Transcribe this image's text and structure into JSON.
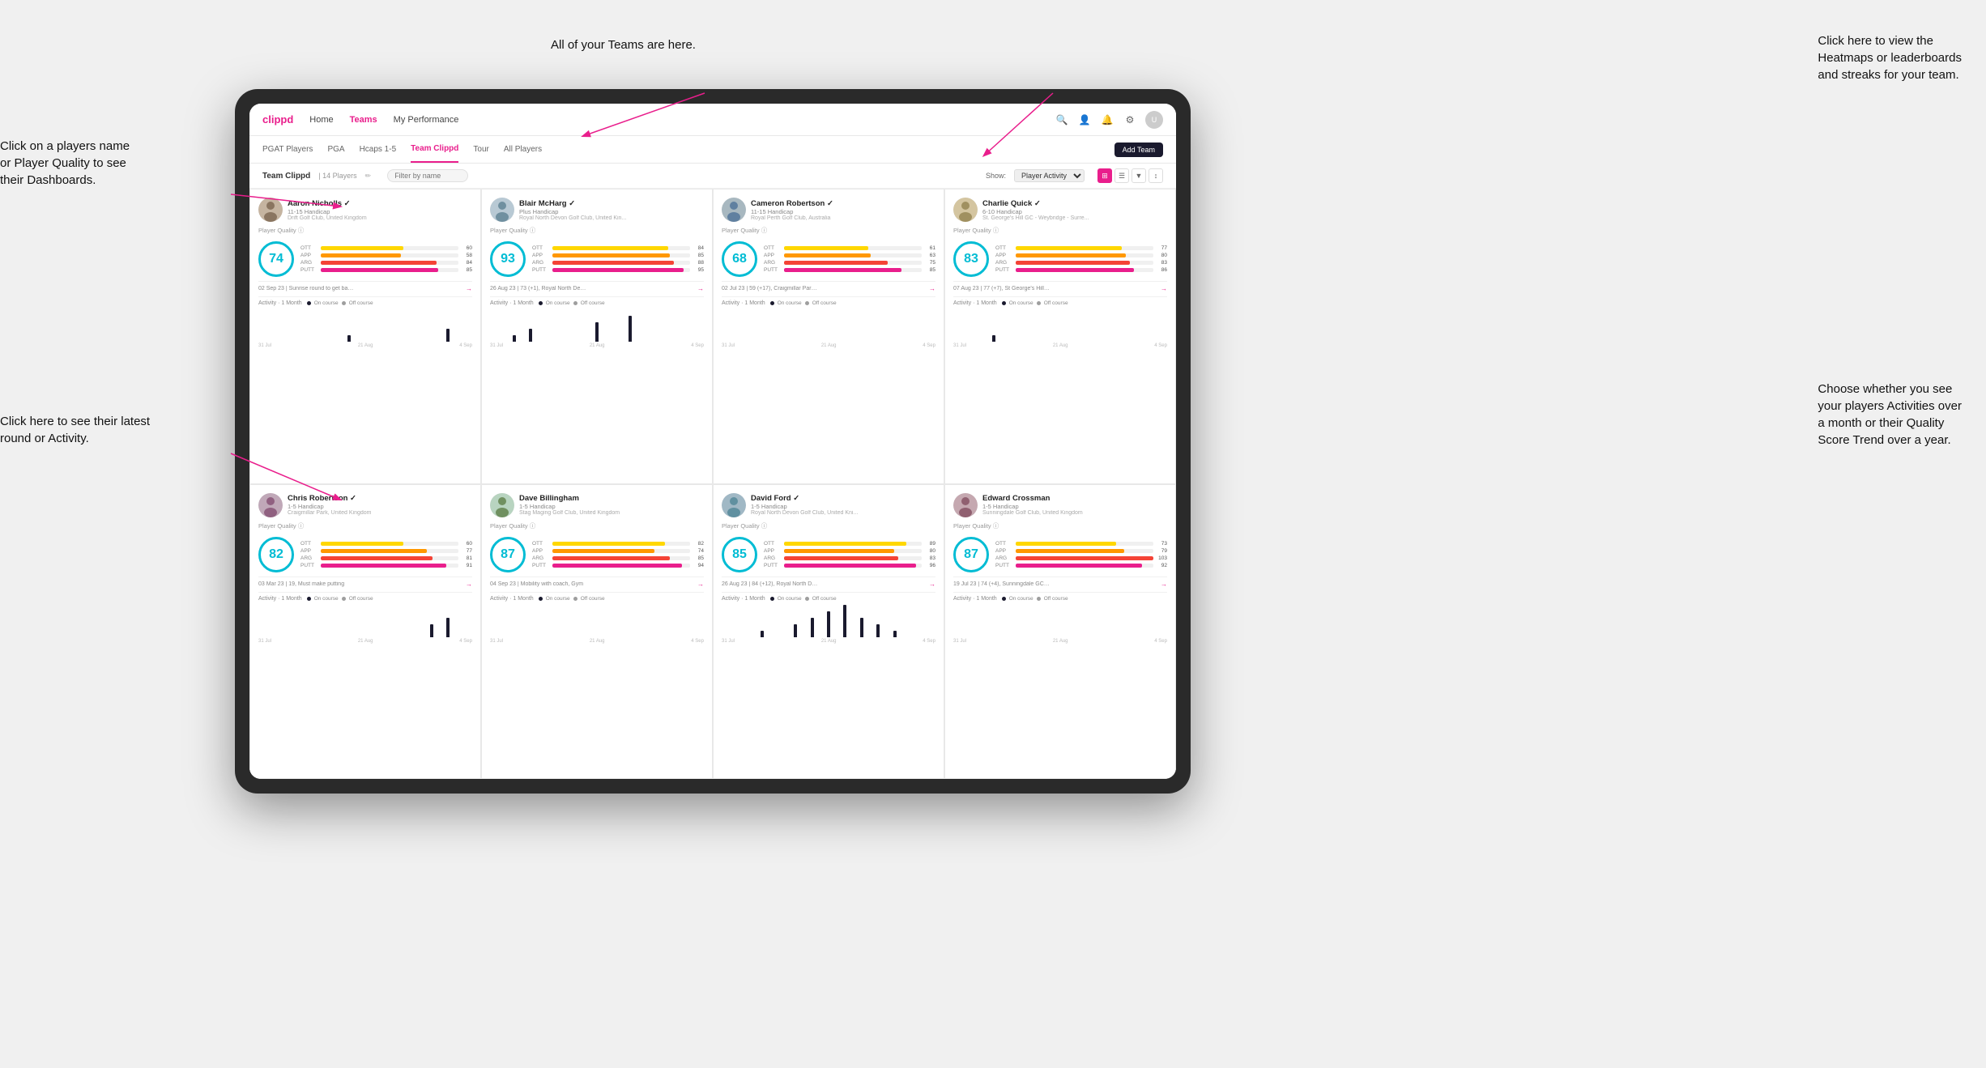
{
  "annotations": {
    "teams_tooltip": "All of your Teams are here.",
    "heatmaps_tooltip": "Click here to view the\nHeatmaps or leaderboards\nand streaks for your team.",
    "players_name_tooltip": "Click on a players name\nor Player Quality to see\ntheir Dashboards.",
    "latest_round_tooltip": "Click here to see their latest\nround or Activity.",
    "activity_tooltip": "Choose whether you see\nyour players Activities over\na month or their Quality\nScore Trend over a year."
  },
  "nav": {
    "logo": "clippd",
    "items": [
      "Home",
      "Teams",
      "My Performance"
    ],
    "active": "Teams",
    "add_team_label": "Add Team"
  },
  "sub_nav": {
    "items": [
      "PGAT Players",
      "PGA",
      "Hcaps 1-5",
      "Team Clippd",
      "Tour",
      "All Players"
    ],
    "active": "Team Clippd"
  },
  "team_header": {
    "name": "Team Clippd",
    "count": "14 Players",
    "filter_placeholder": "Filter by name",
    "show_label": "Show:",
    "show_value": "Player Activity",
    "view_options": [
      "grid",
      "table",
      "filter",
      "sort"
    ]
  },
  "players": [
    {
      "name": "Aaron Nicholls",
      "handicap": "11-15 Handicap",
      "club": "Drift Golf Club, United Kingdom",
      "quality": 74,
      "quality_color": "#00bcd4",
      "stats": {
        "ott": 60,
        "app": 58,
        "arg": 84,
        "putt": 85
      },
      "latest_round": "02 Sep 23 | Sunrise round to get back into it, F...",
      "activity_dates": [
        "31 Jul",
        "21 Aug",
        "4 Sep"
      ],
      "bars": [
        0,
        0,
        0,
        0,
        0,
        1,
        0,
        0,
        0,
        0,
        0,
        2,
        0
      ]
    },
    {
      "name": "Blair McHarg",
      "handicap": "Plus Handicap",
      "club": "Royal North Devon Golf Club, United Kin...",
      "quality": 93,
      "quality_color": "#00bcd4",
      "stats": {
        "ott": 84,
        "app": 85,
        "arg": 88,
        "putt": 95
      },
      "latest_round": "26 Aug 23 | 73 (+1), Royal North Devon GC",
      "activity_dates": [
        "31 Jul",
        "21 Aug",
        "4 Sep"
      ],
      "bars": [
        0,
        1,
        2,
        0,
        0,
        0,
        3,
        0,
        4,
        0,
        0,
        0,
        0
      ]
    },
    {
      "name": "Cameron Robertson",
      "handicap": "11-15 Handicap",
      "club": "Royal Perth Golf Club, Australia",
      "quality": 68,
      "quality_color": "#00bcd4",
      "stats": {
        "ott": 61,
        "app": 63,
        "arg": 75,
        "putt": 85
      },
      "latest_round": "02 Jul 23 | 59 (+17), Craigmillar Park GC",
      "activity_dates": [
        "31 Jul",
        "21 Aug",
        "4 Sep"
      ],
      "bars": [
        0,
        0,
        0,
        0,
        0,
        0,
        0,
        0,
        0,
        0,
        0,
        0,
        0
      ]
    },
    {
      "name": "Charlie Quick",
      "handicap": "6-10 Handicap",
      "club": "St. George's Hill GC - Weybridge - Surre...",
      "quality": 83,
      "quality_color": "#00bcd4",
      "stats": {
        "ott": 77,
        "app": 80,
        "arg": 83,
        "putt": 86
      },
      "latest_round": "07 Aug 23 | 77 (+7), St George's Hill GC - Red...",
      "activity_dates": [
        "31 Jul",
        "21 Aug",
        "4 Sep"
      ],
      "bars": [
        0,
        0,
        1,
        0,
        0,
        0,
        0,
        0,
        0,
        0,
        0,
        0,
        0
      ]
    },
    {
      "name": "Chris Robertson",
      "handicap": "1-5 Handicap",
      "club": "Craigmillar Park, United Kingdom",
      "quality": 82,
      "quality_color": "#00bcd4",
      "stats": {
        "ott": 60,
        "app": 77,
        "arg": 81,
        "putt": 91
      },
      "latest_round": "03 Mar 23 | 19, Must make putting",
      "activity_dates": [
        "31 Jul",
        "21 Aug",
        "4 Sep"
      ],
      "bars": [
        0,
        0,
        0,
        0,
        0,
        0,
        0,
        0,
        0,
        0,
        2,
        3,
        0
      ]
    },
    {
      "name": "Dave Billingham",
      "handicap": "1-5 Handicap",
      "club": "Stag Maging Golf Club, United Kingdom",
      "quality": 87,
      "quality_color": "#00bcd4",
      "stats": {
        "ott": 82,
        "app": 74,
        "arg": 85,
        "putt": 94
      },
      "latest_round": "04 Sep 23 | Mobility with coach, Gym",
      "activity_dates": [
        "31 Jul",
        "21 Aug",
        "4 Sep"
      ],
      "bars": [
        0,
        0,
        0,
        0,
        0,
        0,
        0,
        0,
        0,
        0,
        0,
        0,
        0
      ]
    },
    {
      "name": "David Ford",
      "handicap": "1-5 Handicap",
      "club": "Royal North Devon Golf Club, United Kni...",
      "quality": 85,
      "quality_color": "#00bcd4",
      "stats": {
        "ott": 89,
        "app": 80,
        "arg": 83,
        "putt": 96
      },
      "latest_round": "26 Aug 23 | 84 (+12), Royal North Devon GC",
      "activity_dates": [
        "31 Jul",
        "21 Aug",
        "4 Sep"
      ],
      "bars": [
        0,
        0,
        1,
        0,
        2,
        3,
        4,
        5,
        3,
        2,
        1,
        0,
        0
      ]
    },
    {
      "name": "Edward Crossman",
      "handicap": "1-5 Handicap",
      "club": "Sunningdale Golf Club, United Kingdom",
      "quality": 87,
      "quality_color": "#00bcd4",
      "stats": {
        "ott": 73,
        "app": 79,
        "arg": 103,
        "putt": 92
      },
      "latest_round": "19 Jul 23 | 74 (+4), Sunningdale GC - Old...",
      "activity_dates": [
        "31 Jul",
        "21 Aug",
        "4 Sep"
      ],
      "bars": [
        0,
        0,
        0,
        0,
        0,
        0,
        0,
        0,
        0,
        0,
        0,
        0,
        0
      ]
    }
  ]
}
